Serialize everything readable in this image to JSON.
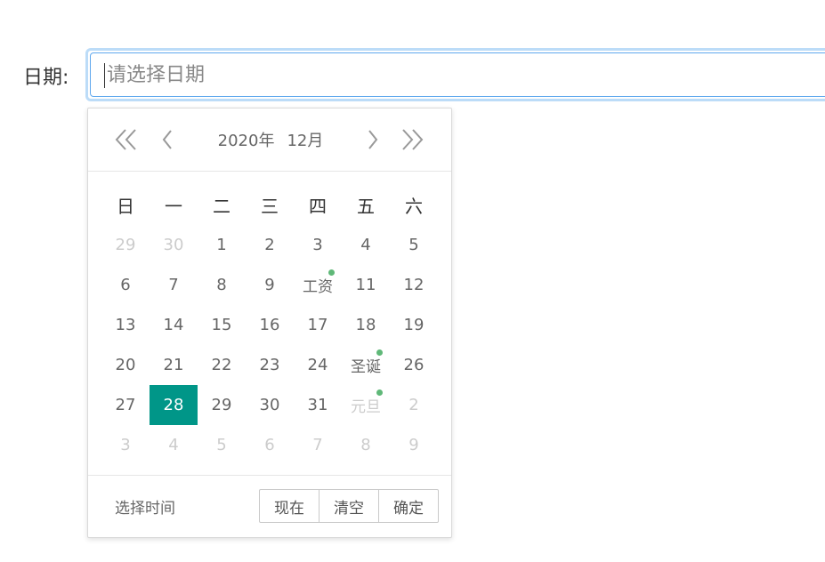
{
  "form": {
    "label": "日期:",
    "placeholder": "请选择日期",
    "value": ""
  },
  "picker": {
    "year": "2020年",
    "month": "12月",
    "nav": {
      "prev_year_icon": "double-chevron-left-icon",
      "prev_month_icon": "chevron-left-icon",
      "next_month_icon": "chevron-right-icon",
      "next_year_icon": "double-chevron-right-icon"
    },
    "weekdays": [
      "日",
      "一",
      "二",
      "三",
      "四",
      "五",
      "六"
    ],
    "weeks": [
      [
        {
          "label": "29",
          "other": true
        },
        {
          "label": "30",
          "other": true
        },
        {
          "label": "1"
        },
        {
          "label": "2"
        },
        {
          "label": "3"
        },
        {
          "label": "4"
        },
        {
          "label": "5"
        }
      ],
      [
        {
          "label": "6"
        },
        {
          "label": "7"
        },
        {
          "label": "8"
        },
        {
          "label": "9"
        },
        {
          "label": "工资",
          "mark": true
        },
        {
          "label": "11"
        },
        {
          "label": "12"
        }
      ],
      [
        {
          "label": "13"
        },
        {
          "label": "14"
        },
        {
          "label": "15"
        },
        {
          "label": "16"
        },
        {
          "label": "17"
        },
        {
          "label": "18"
        },
        {
          "label": "19"
        }
      ],
      [
        {
          "label": "20"
        },
        {
          "label": "21"
        },
        {
          "label": "22"
        },
        {
          "label": "23"
        },
        {
          "label": "24"
        },
        {
          "label": "圣诞",
          "mark": true
        },
        {
          "label": "26"
        }
      ],
      [
        {
          "label": "27"
        },
        {
          "label": "28",
          "selected": true
        },
        {
          "label": "29"
        },
        {
          "label": "30"
        },
        {
          "label": "31"
        },
        {
          "label": "元旦",
          "other": true,
          "mark": true
        },
        {
          "label": "2",
          "other": true
        }
      ],
      [
        {
          "label": "3",
          "other": true
        },
        {
          "label": "4",
          "other": true
        },
        {
          "label": "5",
          "other": true
        },
        {
          "label": "6",
          "other": true
        },
        {
          "label": "7",
          "other": true
        },
        {
          "label": "8",
          "other": true
        },
        {
          "label": "9",
          "other": true
        }
      ]
    ],
    "footer": {
      "select_time": "选择时间",
      "now": "现在",
      "clear": "清空",
      "confirm": "确定"
    }
  },
  "colors": {
    "selected_bg": "#009688",
    "mark_dot": "#5fb878",
    "input_focus_border": "#5fa8ee"
  }
}
